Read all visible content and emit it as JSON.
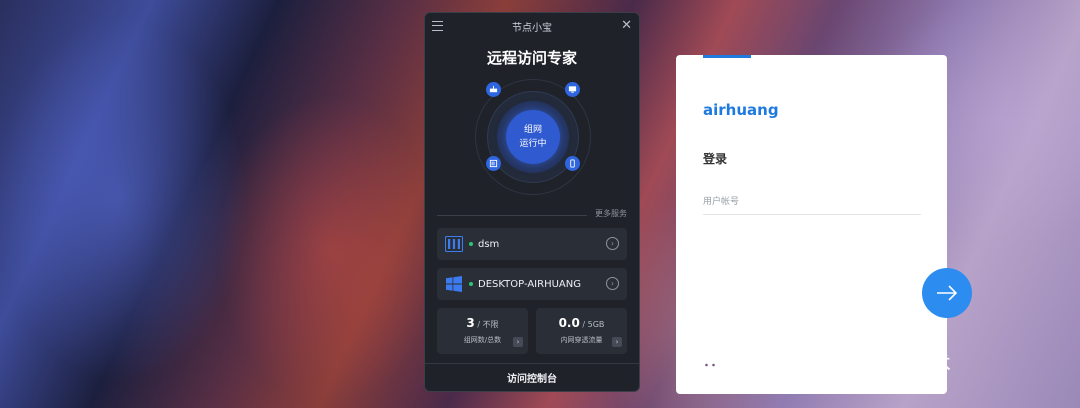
{
  "app": {
    "title": "节点小宝",
    "headline": "远程访问专家",
    "status_line1": "组网",
    "status_line2": "运行中",
    "more_services": "更多服务",
    "devices": [
      {
        "name": "dsm",
        "icon": "nas-icon",
        "online": true
      },
      {
        "name": "DESKTOP-AIRHUANG",
        "icon": "windows-icon",
        "online": true
      }
    ],
    "stats": [
      {
        "value": "3",
        "unit": " / 不限",
        "label": "组网数/总数"
      },
      {
        "value": "0.0",
        "unit": " / 5GB",
        "label": "内网穿透流量"
      }
    ],
    "footer_label": "访问控制台",
    "accent_color": "#2f5ad0"
  },
  "login": {
    "username": "airhuang",
    "heading": "登录",
    "account_placeholder": "用户帐号",
    "accent_color": "#1f7ae0"
  },
  "watermark": {
    "text": "公众号 · 小白电脑技术"
  }
}
